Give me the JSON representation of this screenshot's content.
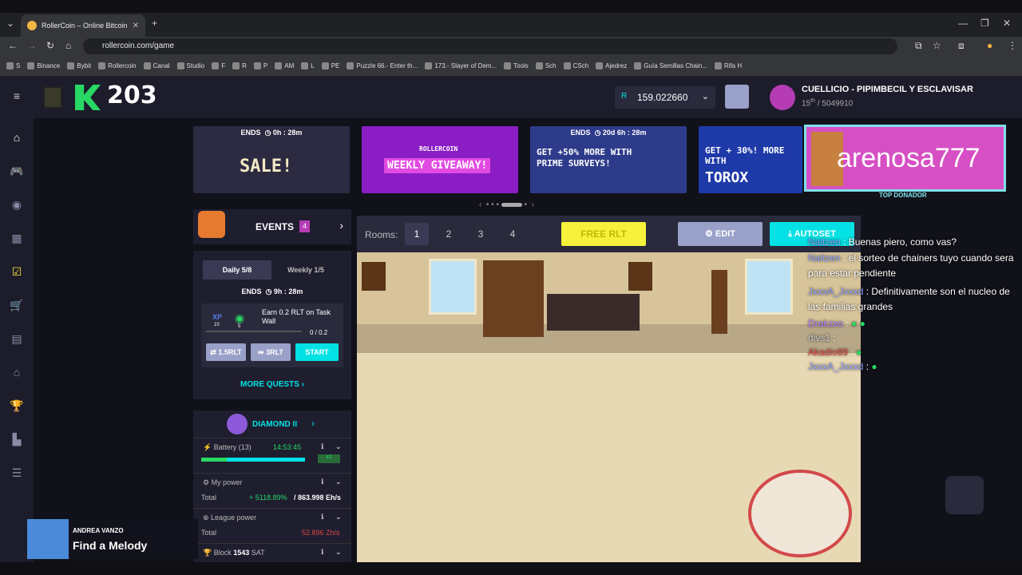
{
  "browser": {
    "tab_title": "RollerCoin – Online Bitcoin Min",
    "url": "rollercoin.com/game",
    "bookmarks": [
      "S",
      "Binance",
      "Bybit",
      "Rollercoin",
      "Canal",
      "Studio",
      "F",
      "R",
      "P",
      "AM",
      "L",
      "PE",
      "Puzzle 66.- Enter th...",
      "173.- Slayer of Dem...",
      "Tools",
      "Sch",
      "CSch",
      "Ajedrez",
      "Guía Semillas Chain...",
      "Rifa H"
    ]
  },
  "header": {
    "level": "203",
    "balance": "159.022660",
    "balance_currency": "R",
    "username": "CUELLICIO - PIPIMBECIL Y ESCLAVISAR",
    "rank": "15",
    "rank_suffix": "th",
    "rank_total": "/ 5049910"
  },
  "banners": [
    {
      "ends": "ENDS",
      "time": "0h : 28m",
      "text": "SALE!"
    },
    {
      "text": "ROLLERCOIN",
      "text2": "WEEKLY GIVEAWAY!"
    },
    {
      "ends": "ENDS",
      "time": "20d 6h : 28m",
      "text": "GET +50% MORE WITH PRIME SURVEYS!"
    },
    {
      "text": "GET + 30%! MORE WITH",
      "text2": "TOROX"
    }
  ],
  "donor": {
    "name": "arenosa777",
    "label": "TOP DONADOR"
  },
  "events": {
    "title": "EVENTS",
    "count": "4",
    "tab_daily": "Daily  5/8",
    "tab_weekly": "Weekly  1/5",
    "ends": "ENDS",
    "time": "9h : 28m",
    "quest_text": "Earn 0.2 RLT on Task Wall",
    "quest_progress": "0 / 0.2",
    "quest_xp": "10",
    "quest_rlt": "5",
    "progress_fraction": 0,
    "btn_1": "1.5RLT",
    "btn_2": "3RLT",
    "btn_start": "START",
    "more": "MORE QUESTS"
  },
  "league": {
    "name": "DIAMOND II",
    "battery_label": "Battery (13)",
    "battery_time": "14:53:45",
    "battery_badge": "x1",
    "my_power": "My power",
    "total": "Total",
    "my_power_pct": "+ 5118.89%",
    "my_power_val": "863.998 Eh/s",
    "league_power": "League power",
    "league_total": "Total",
    "league_val": "52.896 Zh/s",
    "block_label": "Block",
    "block_num": "1543",
    "block_unit": "SAT"
  },
  "rooms": {
    "label": "Rooms:",
    "items": [
      "1",
      "2",
      "3",
      "4"
    ],
    "free_rlt": "FREE RLT",
    "edit": "EDIT",
    "autoset": "AUTOSET"
  },
  "chat": [
    {
      "user": "Naitzen",
      "text": ": Buenas piero, como vas?"
    },
    {
      "user": "Naitzen",
      "text": ": el sorteo de chainers tuyo cuando sera para estar pendiente"
    },
    {
      "user": "JxxxA_Jxxxd",
      "text": ": Definitivamente son el nucleo de las familias grandes"
    },
    {
      "user": "Drakzxo",
      "text": ":"
    },
    {
      "user": "divs1",
      "text": ":"
    },
    {
      "user": "Akadio89",
      "text": ":"
    },
    {
      "user": "JxxxA_Jxxxd",
      "text": ":"
    }
  ],
  "music": {
    "artist": "ANDREA VANZO",
    "title": "Find a Melody"
  },
  "colors": {
    "accent": "#03e1e4",
    "pink": "#e14be1",
    "green": "#28d864",
    "bg": "#11111a",
    "panel": "#1e1e2f"
  }
}
